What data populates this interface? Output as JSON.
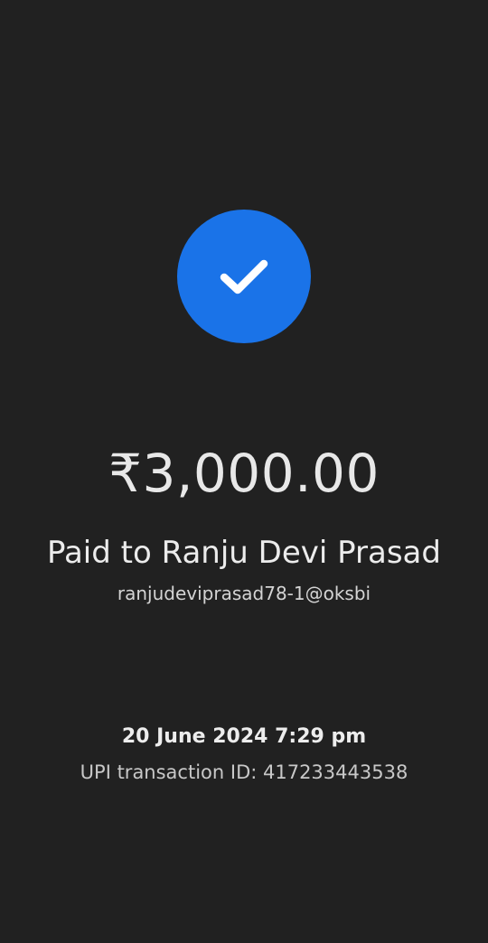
{
  "status": {
    "icon": "check-icon",
    "accent_color": "#1a73e8"
  },
  "payment": {
    "amount": "₹3,000.00",
    "payee_line": "Paid to Ranju Devi Prasad",
    "payee_upi": "ranjudeviprasad78-1@oksbi",
    "datetime": "20 June 2024 7:29 pm",
    "transaction_line": "UPI transaction ID: 417233443538"
  }
}
